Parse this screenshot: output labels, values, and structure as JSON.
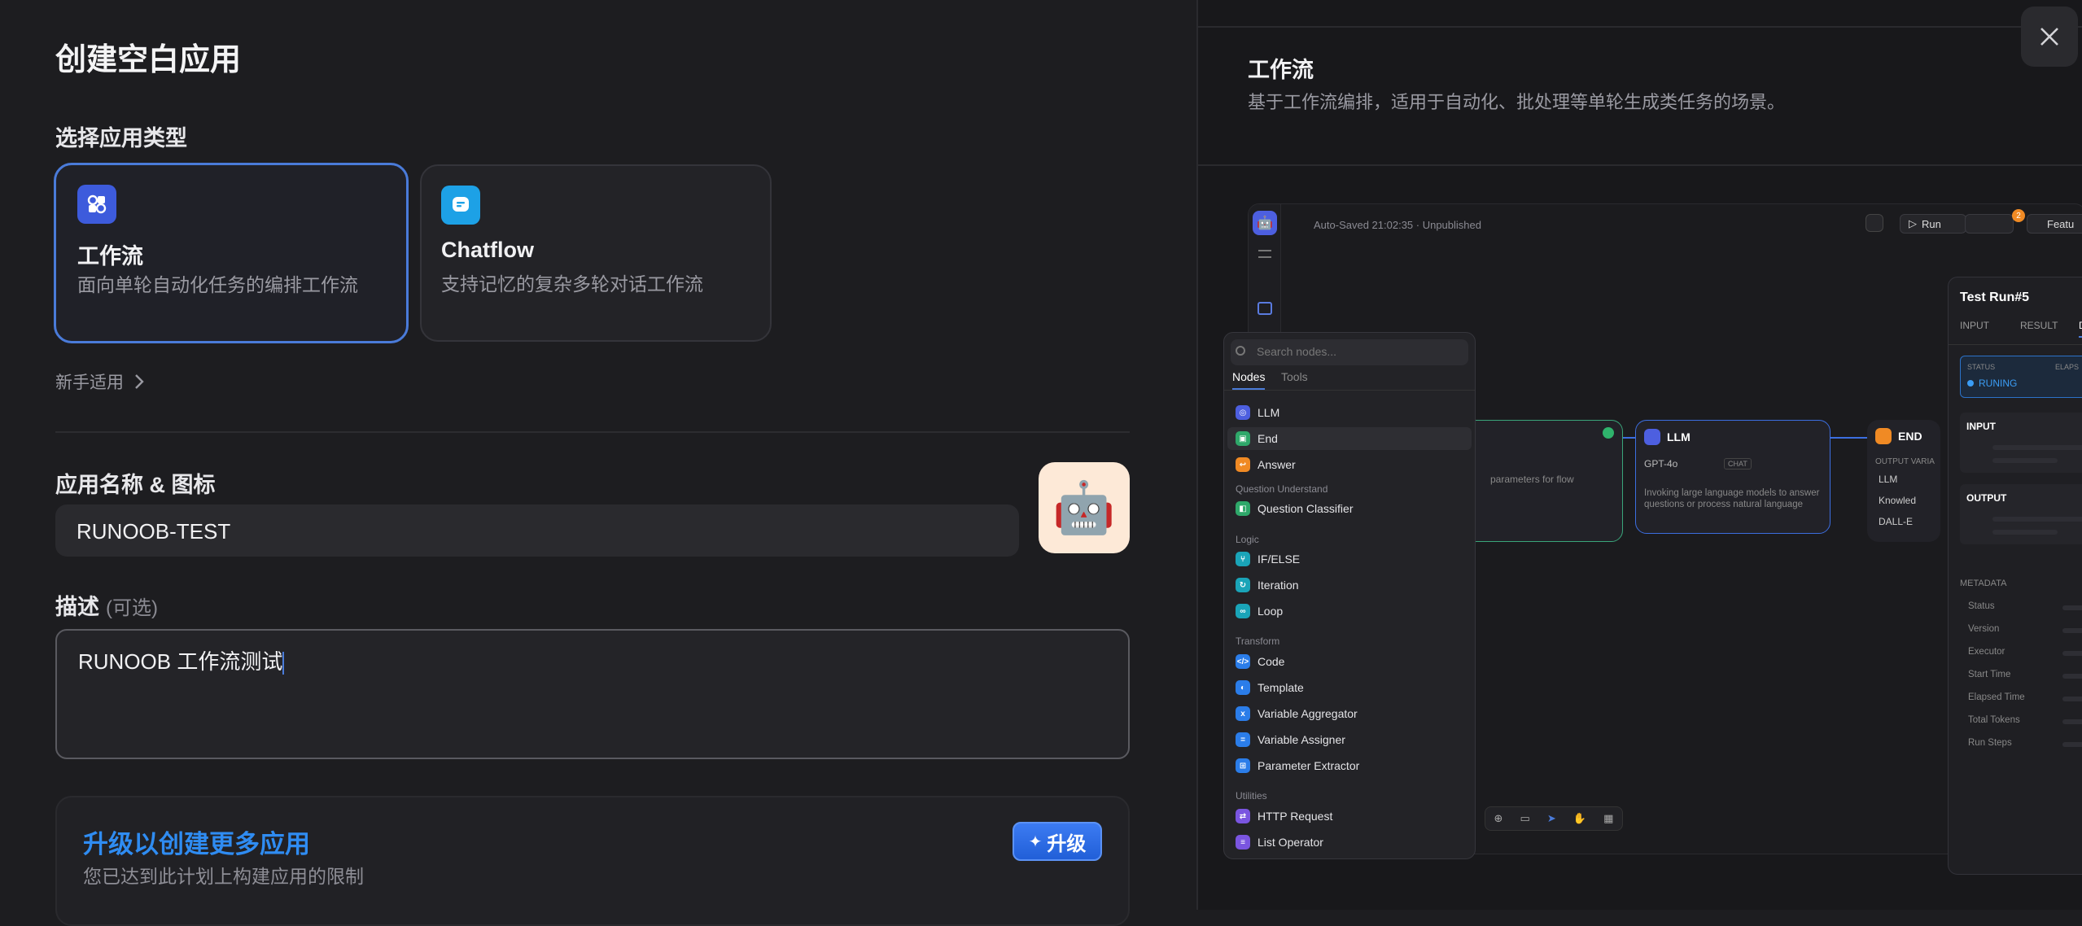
{
  "dialog": {
    "title": "创建空白应用",
    "type_section": "选择应用类型",
    "types": [
      {
        "title": "工作流",
        "desc": "面向单轮自动化任务的编排工作流",
        "selected": true,
        "color": "#3d5bdc"
      },
      {
        "title": "Chatflow",
        "desc": "支持记忆的复杂多轮对话工作流",
        "selected": false,
        "color": "#1da1e6"
      }
    ],
    "beginner_link": "新手适用",
    "name_section": "应用名称 & 图标",
    "name_value": "RUNOOB-TEST",
    "app_icon": "🤖",
    "desc_section": "描述",
    "desc_optional": "(可选)",
    "desc_value": "RUNOOB 工作流测试",
    "upgrade": {
      "title": "升级以创建更多应用",
      "subtitle": "您已达到此计划上构建应用的限制",
      "button": "升级"
    }
  },
  "preview": {
    "title": "工作流",
    "desc": "基于工作流编排，适用于自动化、批处理等单轮生成类任务的场景。",
    "autosave": "Auto-Saved 21:02:35 · Unpublished",
    "run_label": "Run",
    "features_label": "Featu",
    "badge": "2",
    "search_placeholder": "Search nodes...",
    "tabs": [
      "Nodes",
      "Tools"
    ],
    "menu": {
      "top": [
        "LLM",
        "End",
        "Answer"
      ],
      "g1": "Question Understand",
      "g1_items": [
        "Question Classifier"
      ],
      "g2": "Logic",
      "g2_items": [
        "IF/ELSE",
        "Iteration",
        "Loop"
      ],
      "g3": "Transform",
      "g3_items": [
        "Code",
        "Template",
        "Variable Aggregator",
        "Variable Assigner",
        "Parameter Extractor"
      ],
      "g4": "Utilities",
      "g4_items": [
        "HTTP Request",
        "List Operator"
      ]
    },
    "llm_node": {
      "title": "LLM",
      "model": "GPT-4o",
      "tag": "CHAT",
      "desc": "Invoking large language models to answer questions or process natural language"
    },
    "start_node_text": "parameters for flow",
    "end_node": {
      "title": "END",
      "sub": "OUTPUT VARIA",
      "items": [
        "LLM",
        "Knowled",
        "DALL-E"
      ]
    },
    "test_run": {
      "title": "Test Run#5",
      "tabs": [
        "INPUT",
        "RESULT",
        "DE"
      ],
      "status_label": "STATUS",
      "elapsed_label": "ELAPS",
      "status": "RUNING",
      "input": "INPUT",
      "output": "OUTPUT",
      "metadata": "METADATA",
      "meta_rows": [
        "Status",
        "Version",
        "Executor",
        "Start Time",
        "Elapsed Time",
        "Total Tokens",
        "Run Steps"
      ]
    }
  }
}
